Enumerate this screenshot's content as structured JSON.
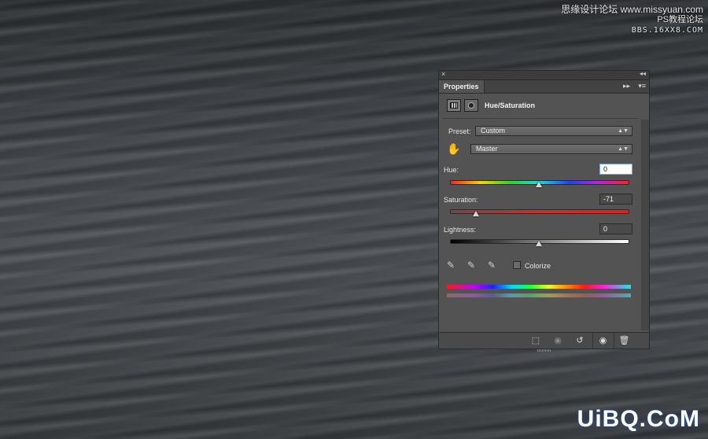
{
  "watermark": {
    "top_line1": "思缘设计论坛 www.missyuan.com",
    "top_line2": "PS教程论坛",
    "top_line3": "BBS.16XX8.COM",
    "bottom": "UiBQ.CoM"
  },
  "panel": {
    "close_glyph": "×",
    "collapse_glyph": "◂◂",
    "tab_label": "Properties",
    "forward_glyph": "▸▸",
    "menu_glyph": "▾≡",
    "adjustment_title": "Hue/Saturation",
    "preset": {
      "label": "Preset:",
      "value": "Custom"
    },
    "channel": {
      "value": "Master",
      "icon": "targeted-adjustment-hand-icon"
    },
    "hue": {
      "label": "Hue:",
      "value": "0",
      "slider_fraction": 0.5
    },
    "saturation": {
      "label": "Saturation:",
      "value": "-71",
      "slider_fraction": 0.145
    },
    "lightness": {
      "label": "Lightness:",
      "value": "0",
      "slider_fraction": 0.5
    },
    "colorize": {
      "label": "Colorize",
      "checked": false
    },
    "droppers": [
      "eyedropper-icon",
      "eyedropper-plus-icon",
      "eyedropper-minus-icon"
    ],
    "bottom_buttons": [
      "clip-to-layer-icon",
      "view-previous-state-icon",
      "reset-icon",
      "visibility-eye-icon",
      "trash-icon"
    ]
  }
}
